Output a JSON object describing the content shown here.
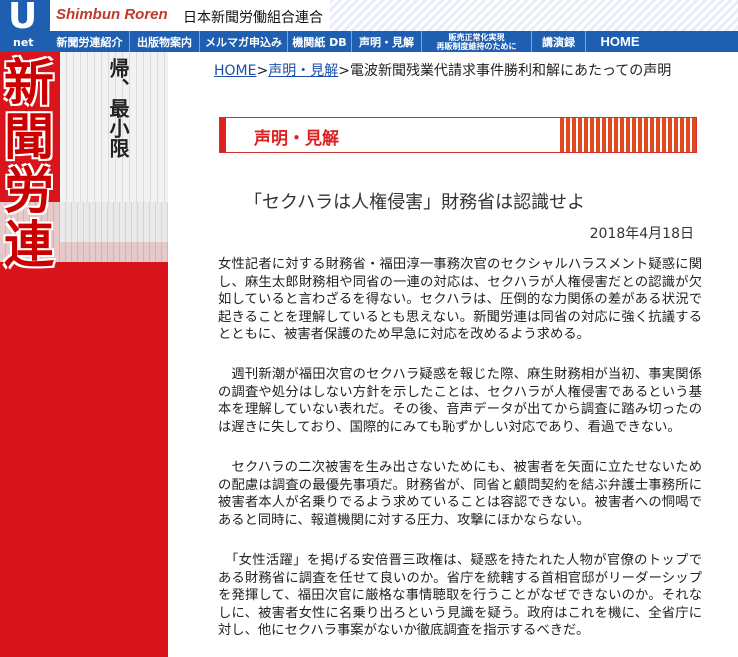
{
  "header": {
    "logo_letter": "U",
    "logo_sub": "net",
    "brand_en": "Shimbun Roren",
    "brand_jp": "日本新聞労働組合連合"
  },
  "nav": {
    "items": [
      {
        "label": "新聞労連紹介"
      },
      {
        "label": "出版物案内"
      },
      {
        "label": "メルマガ申込み"
      },
      {
        "label": "機関紙 DB"
      },
      {
        "label": "声明・見解"
      },
      {
        "label_line1": "販売正常化実現",
        "label_line2": "再販制度維持のために"
      },
      {
        "label": "講演録"
      },
      {
        "label": "HOME"
      }
    ]
  },
  "sidebar": {
    "title_chars": "新聞労連",
    "clip_text": "帰、最小限"
  },
  "breadcrumb": {
    "home": "HOME",
    "sep1": ">",
    "section": "声明・見解",
    "sep2": ">",
    "current": "電波新聞残業代請求事件勝利和解にあたっての声明"
  },
  "banner": {
    "label": "声明・見解"
  },
  "article": {
    "headline": "「セクハラは人権侵害」財務省は認識せよ",
    "date": "2018年4月18日",
    "paragraphs": [
      "女性記者に対する財務省・福田淳一事務次官のセクシャルハラスメント疑惑に関し、麻生太郎財務相や同省の一連の対応は、セクハラが人権侵害だとの認識が欠如していると言わざるを得ない。セクハラは、圧倒的な力関係の差がある状況で起きることを理解しているとも思えない。新聞労連は同省の対応に強く抗議するとともに、被害者保護のため早急に対応を改めるよう求める。",
      "　週刊新潮が福田次官のセクハラ疑惑を報じた際、麻生財務相が当初、事実関係の調査や処分はしない方針を示したことは、セクハラが人権侵害であるという基本を理解していない表れだ。その後、音声データが出てから調査に踏み切ったのは遅きに失しており、国際的にみても恥ずかしい対応であり、看過できない。",
      "　セクハラの二次被害を生み出さないためにも、被害者を矢面に立たせないための配慮は調査の最優先事項だ。財務省が、同省と顧問契約を結ぶ弁護士事務所に被害者本人が名乗りでるよう求めていることは容認できない。被害者への恫喝であると同時に、報道機関に対する圧力、攻撃にほかならない。",
      "　「女性活躍」を掲げる安倍晋三政権は、疑惑を持たれた人物が官僚のトップである財務省に調査を任せて良いのか。省庁を統轄する首相官邸がリーダーシップを発揮して、福田次官に厳格な事情聴取を行うことがなぜできないのか。それなしに、被害者女性に名乗り出ろという見識を疑う。政府はこれを機に、全省庁に対し、他にセクハラ事案がないか徹底調査を指示するべきだ。"
    ]
  },
  "colors": {
    "nav_bg": "#1f5fb2",
    "sidebar_red": "#d9141b",
    "accent_red": "#d22",
    "link": "#1a4ea8"
  }
}
